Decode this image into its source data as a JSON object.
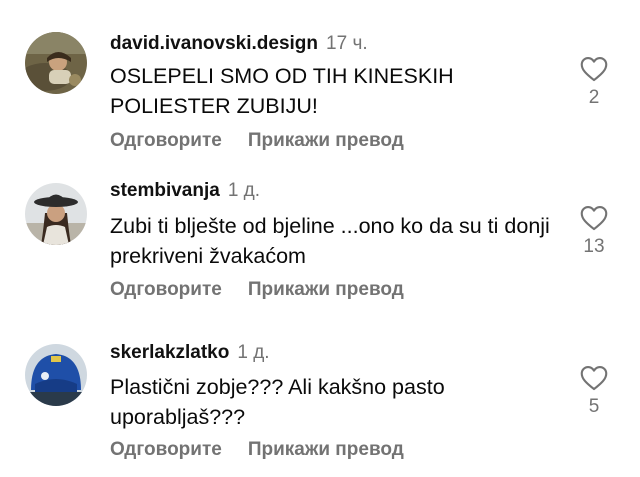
{
  "comments": [
    {
      "username": "david.ivanovski.design",
      "time": "17 ч.",
      "text": "OSLEPELI SMO OD TIH KINESKIH POLIESTER ZUBIJU!",
      "likes": "2",
      "reply_label": "Одговорите",
      "translate_label": "Прикажи превод",
      "avatar_icon": "person-outdoor-avatar"
    },
    {
      "username": "stembivanja",
      "time": "1 д.",
      "text": "Zubi ti bljеšte od bjeline ...ono ko da su ti donji prekriveni žvakaćom",
      "likes": "13",
      "reply_label": "Одговорите",
      "translate_label": "Прикажи превод",
      "avatar_icon": "woman-hat-avatar"
    },
    {
      "username": "skerlakzlatko",
      "time": "1 д.",
      "text": "Plastični zobje??? Ali kakšno pasto uporabljaš???",
      "likes": "5",
      "reply_label": "Одговорите",
      "translate_label": "Прикажи превод",
      "avatar_icon": "blue-helmet-avatar"
    }
  ],
  "colors": {
    "text": "#0a0a0a",
    "secondary": "#737373",
    "background": "#ffffff"
  }
}
